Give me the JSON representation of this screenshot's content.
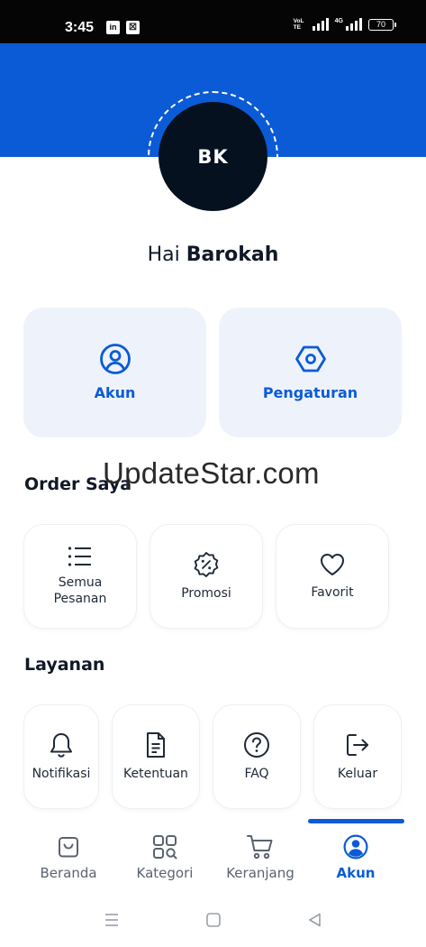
{
  "status_bar": {
    "time": "3:45",
    "app_icons": [
      "in",
      "☒"
    ],
    "volte": "VoLTE",
    "network": "4G",
    "battery": "70"
  },
  "profile": {
    "initials": "BK",
    "greeting_prefix": "Hai",
    "name": "Barokah"
  },
  "quick_actions": [
    {
      "label": "Akun",
      "icon": "user-circle-icon"
    },
    {
      "label": "Pengaturan",
      "icon": "hexagon-settings-icon"
    }
  ],
  "order_section": {
    "title": "Order Saya",
    "items": [
      {
        "label": "Semua Pesanan",
        "icon": "list-icon"
      },
      {
        "label": "Promosi",
        "icon": "discount-badge-icon"
      },
      {
        "label": "Favorit",
        "icon": "heart-icon"
      }
    ]
  },
  "services_section": {
    "title": "Layanan",
    "items": [
      {
        "label": "Notifikasi",
        "icon": "bell-icon"
      },
      {
        "label": "Ketentuan",
        "icon": "document-icon"
      },
      {
        "label": "FAQ",
        "icon": "question-circle-icon"
      },
      {
        "label": "Keluar",
        "icon": "logout-icon"
      }
    ]
  },
  "bottom_nav": {
    "active": "Akun",
    "items": [
      {
        "label": "Beranda",
        "icon": "shopping-bag-icon"
      },
      {
        "label": "Kategori",
        "icon": "category-grid-icon"
      },
      {
        "label": "Keranjang",
        "icon": "cart-icon"
      },
      {
        "label": "Akun",
        "icon": "account-icon"
      }
    ]
  },
  "watermark": "UpdateStar.com",
  "colors": {
    "primary": "#0b5bd6",
    "card_bg": "#eef3fb",
    "avatar_bg": "#06111f",
    "text": "#111827",
    "muted": "#5b6270"
  }
}
